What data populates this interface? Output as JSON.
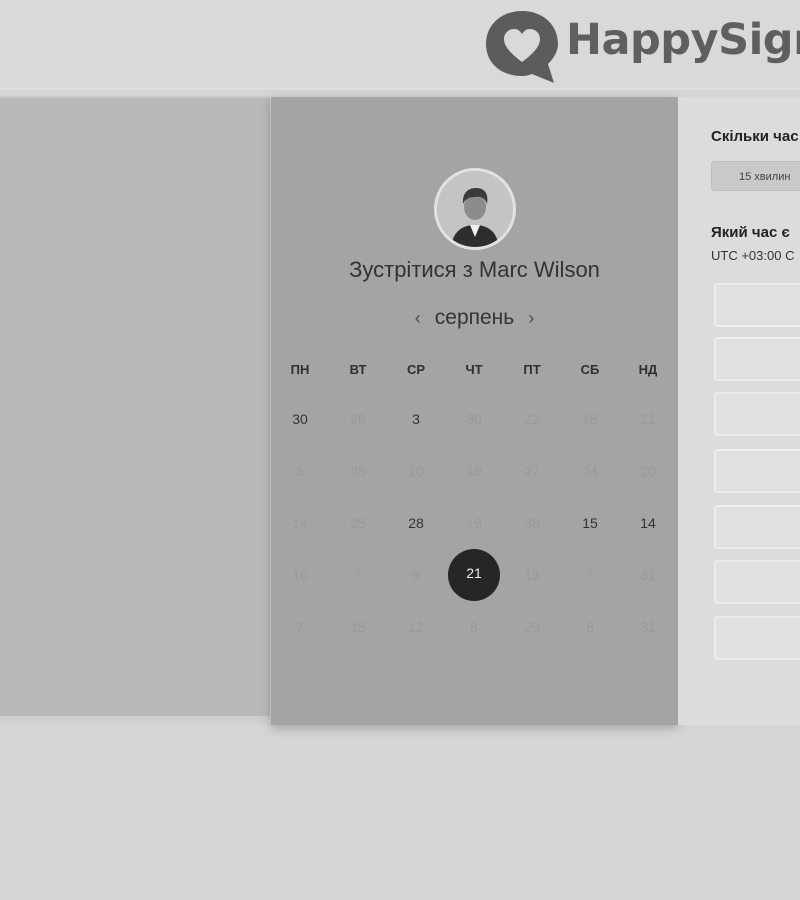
{
  "header": {
    "logo_text": "HappySign",
    "logo_icon": "heart-speech-bubble-icon"
  },
  "calendar": {
    "title": "Зустрітися з Marc Wilson",
    "month": "серпень",
    "prev_icon": "chevron-left-icon",
    "next_icon": "chevron-right-icon",
    "weekdays": [
      "ПН",
      "ВТ",
      "СР",
      "ЧТ",
      "ПТ",
      "СБ",
      "НД"
    ],
    "weeks": [
      [
        "30",
        "26",
        "3",
        "30",
        "22",
        "18",
        "21"
      ],
      [
        "5",
        "25",
        "10",
        "19",
        "27",
        "24",
        "20"
      ],
      [
        "14",
        "25",
        "28",
        "19",
        "30",
        "15",
        "14"
      ],
      [
        "16",
        "7",
        "9",
        "21",
        "13",
        "7",
        "31"
      ],
      [
        "7",
        "15",
        "12",
        "8",
        "29",
        "8",
        "31"
      ]
    ],
    "selected_day": "21"
  },
  "booking": {
    "duration_heading": "Скільки час",
    "duration_option": "15 хвилин",
    "time_heading": "Який час є",
    "timezone": "UTC +03:00 С"
  },
  "colors": {
    "page_bg": "#d6d6d6",
    "calendar_bg": "#a4a4a4",
    "selected_day_bg": "#262626"
  }
}
